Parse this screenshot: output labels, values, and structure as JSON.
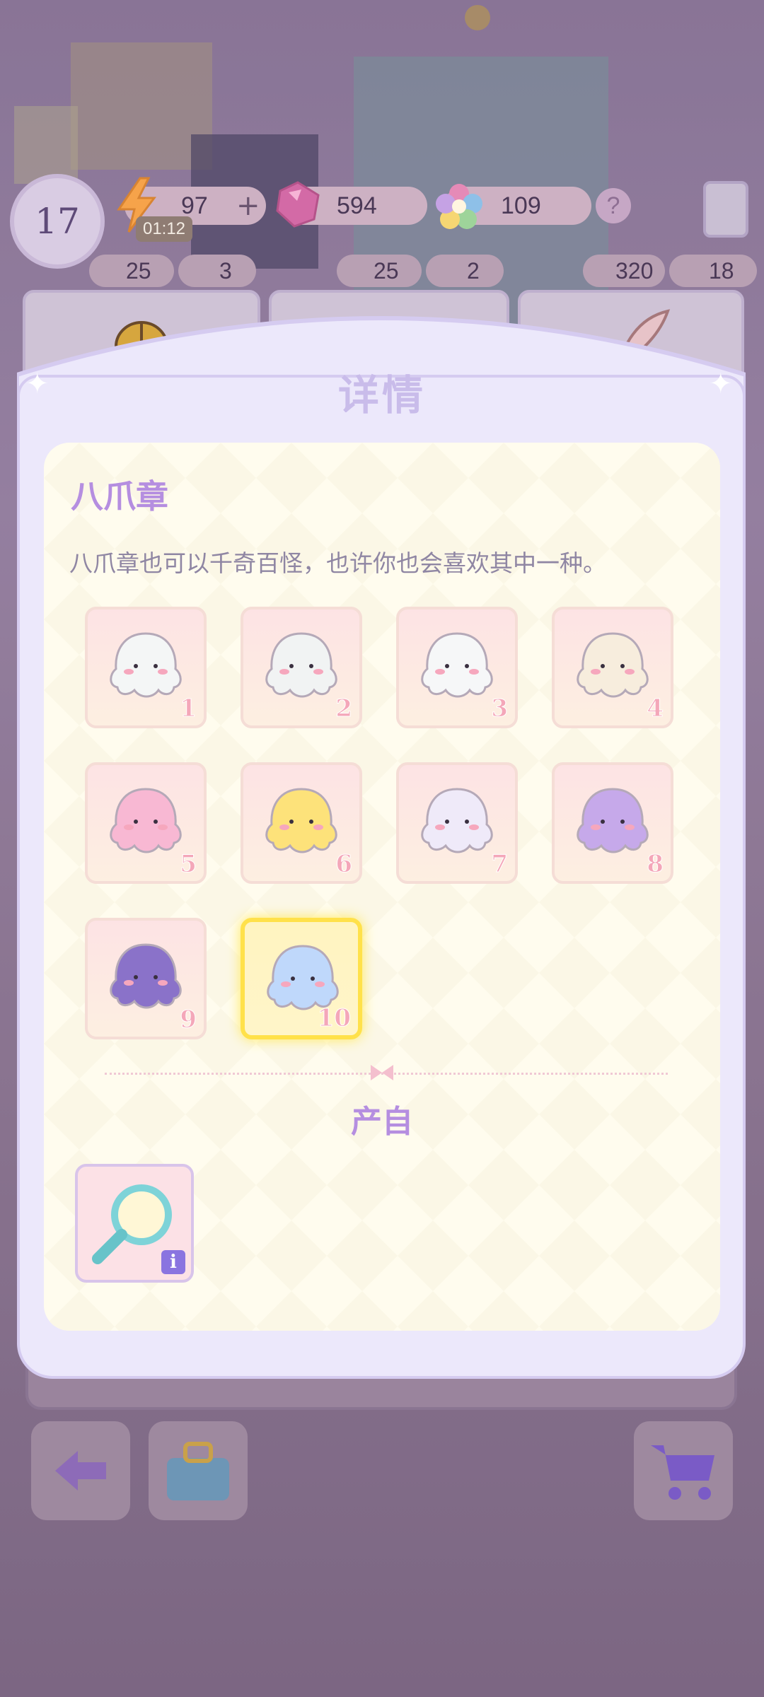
{
  "hud": {
    "level": "17",
    "energy": "97",
    "energy_plus": "+",
    "energy_timer": "01:12",
    "gems": "594",
    "stars": "109",
    "help": "?"
  },
  "shop": {
    "costs": [
      {
        "energy": "25",
        "gems": "3"
      },
      {
        "energy": "25",
        "gems": "2"
      },
      {
        "energy": "320",
        "gems": "18"
      }
    ]
  },
  "modal": {
    "title": "详情",
    "item_name": "八爪章",
    "description": "八爪章也可以千奇百怪，也许你也会喜欢其中一种。",
    "variants": [
      {
        "num": "1",
        "color": "#f4f6f6",
        "selected": false
      },
      {
        "num": "2",
        "color": "#f1f3f3",
        "selected": false
      },
      {
        "num": "3",
        "color": "#f6f7f8",
        "selected": false
      },
      {
        "num": "4",
        "color": "#f7eddd",
        "selected": false
      },
      {
        "num": "5",
        "color": "#f8b8d3",
        "selected": false
      },
      {
        "num": "6",
        "color": "#fde27a",
        "selected": false
      },
      {
        "num": "7",
        "color": "#efeaf9",
        "selected": false
      },
      {
        "num": "8",
        "color": "#c6a9ea",
        "selected": false
      },
      {
        "num": "9",
        "color": "#8a72c9",
        "selected": false
      },
      {
        "num": "10",
        "color": "#bfd8fb",
        "selected": true
      }
    ],
    "source_label": "产自",
    "source_info": "i"
  },
  "colors": {
    "accent": "#b58ee0",
    "selected_border": "#ffe14a"
  }
}
